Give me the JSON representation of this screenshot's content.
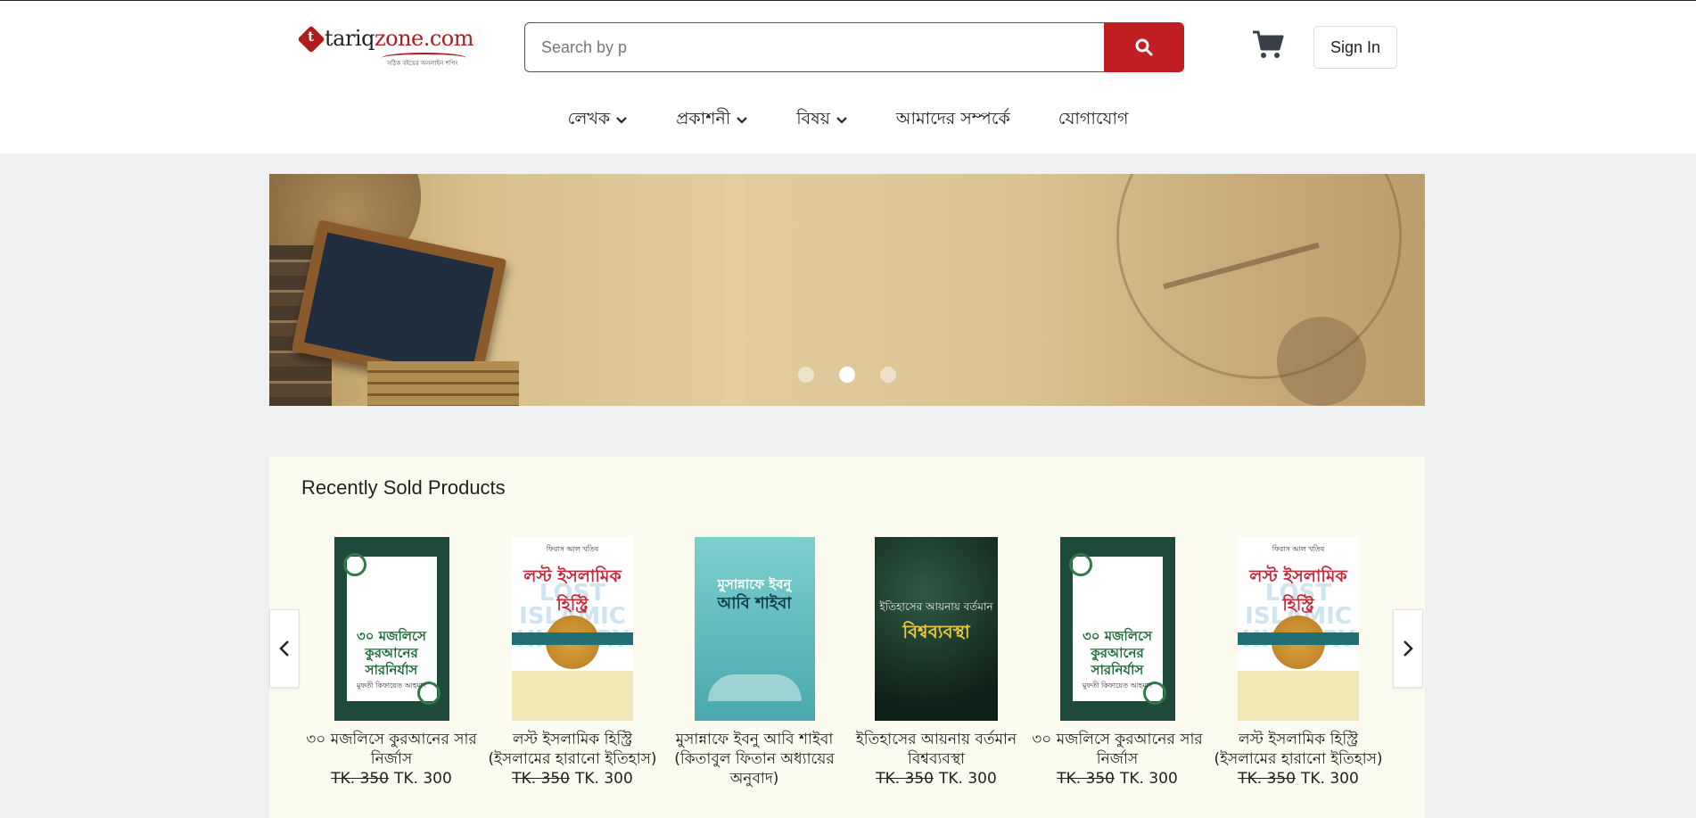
{
  "header": {
    "logo": {
      "text_main": "tariq",
      "text_accent": "zone.com",
      "tagline": "সঠিক বইয়ের অনলাইন শপিং"
    },
    "search": {
      "placeholder": "Search by p"
    },
    "signin_label": "Sign In"
  },
  "nav": {
    "items": [
      {
        "label": "লেখক",
        "has_dropdown": true
      },
      {
        "label": "প্রকাশনী",
        "has_dropdown": true
      },
      {
        "label": "বিষয়",
        "has_dropdown": true
      },
      {
        "label": "আমাদের সম্পর্কে",
        "has_dropdown": false
      },
      {
        "label": "যোগাযোগ",
        "has_dropdown": false
      }
    ]
  },
  "banner": {
    "slide_count": 3,
    "active_slide": 2
  },
  "colors": {
    "accent": "#c21f24",
    "panel": "#fcfbf0",
    "page_bg": "#eef0f2"
  },
  "recent": {
    "title": "Recently Sold Products",
    "products": [
      {
        "title": "৩০ মজলিসে কুরআনের সার নির্জাস",
        "old_price": "TK. 350",
        "price": "TK. 300",
        "cover": "green",
        "cover_title": "৩০ মজলিসে কুরআনের সারনির্যাস",
        "cover_author": "মুফতী কিফায়েত আহমাদ"
      },
      {
        "title": "লস্ট ইসলামিক হিস্ট্রি (ইসলামের হারানো ইতিহাস)",
        "old_price": "TK. 350",
        "price": "TK. 300",
        "cover": "lost",
        "cover_top": "ফিরাস আল খতিব",
        "cover_title": "লস্ট ইসলামিক হিস্ট্রি",
        "cover_ghost": "LOST ISLAMIC HISTORY"
      },
      {
        "title": "মুসান্নাফে ইবনু আবি শাইবা (কিতাবুল ফিতান অধ্যায়ের অনুবাদ)",
        "old_price": "",
        "price": "",
        "cover": "teal",
        "cover_title": "মুসান্নাফে ইবনু",
        "cover_title2": "আবি শাইবা"
      },
      {
        "title": "ইতিহাসের আয়নায় বর্তমান বিশ্বব্যবস্থা",
        "old_price": "TK. 350",
        "price": "TK. 300",
        "cover": "dark",
        "cover_title": "ইতিহাসের আয়নায় বর্তমান",
        "cover_title2": "বিশ্বব্যবস্থা"
      },
      {
        "title": "৩০ মজলিসে কুরআনের সার নির্জাস",
        "old_price": "TK. 350",
        "price": "TK. 300",
        "cover": "green",
        "cover_title": "৩০ মজলিসে কুরআনের সারনির্যাস",
        "cover_author": "মুফতী কিফায়েত আহমাদ"
      },
      {
        "title": "লস্ট ইসলামিক হিস্ট্রি (ইসলামের হারানো ইতিহাস)",
        "old_price": "TK. 350",
        "price": "TK. 300",
        "cover": "lost",
        "cover_top": "ফিরাস আল খতিব",
        "cover_title": "লস্ট ইসলামিক হিস্ট্রি",
        "cover_ghost": "LOST ISLAMIC HISTORY"
      }
    ]
  }
}
